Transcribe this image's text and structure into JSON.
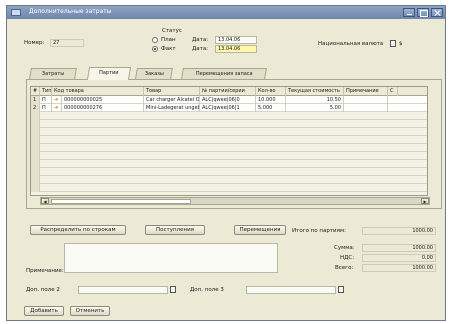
{
  "window": {
    "title": "Дополнительные затраты"
  },
  "header": {
    "number_label": "Номер:",
    "number_value": "27",
    "status_label": "Статус",
    "status_plan": "План",
    "status_fact": "Факт",
    "date_label": "Дата:",
    "date_plan": "13.04.06",
    "date_fact": "13.04.06",
    "currency_label": "Национальная валюта",
    "currency_value": "$"
  },
  "tabs": [
    "Затраты",
    "Партии",
    "Заказы",
    "Перемещения запаса"
  ],
  "grid": {
    "columns": [
      "#",
      "Тип",
      "Код товара",
      "Товар",
      "№ партии/серии",
      "Кол-во",
      "Текущая стоимость",
      "Примечание",
      "С"
    ],
    "rows": [
      {
        "n": "1",
        "type": "П",
        "code": "000000000025",
        "item": "Car charger Alcatel OT",
        "batch": "ALC|qwee|06|0",
        "qty": "10.000",
        "cost": "10.50",
        "note": ""
      },
      {
        "n": "2",
        "type": "П",
        "code": "000000000276",
        "item": "Mini-Ladegerat ungebl",
        "batch": "ALC|qwee|06|1",
        "qty": "5.000",
        "cost": "5.00",
        "note": ""
      }
    ]
  },
  "buttons": {
    "distribute": "Распределить по строкам",
    "receipts": "Поступления",
    "moves": "Перемещения",
    "add": "Добавить",
    "cancel": "Отменить"
  },
  "totals": {
    "by_batches_label": "Итого по партиям:",
    "by_batches_value": "1000.00",
    "sum_label": "Сумма:",
    "sum_value": "1000.00",
    "vat_label": "НДС:",
    "vat_value": "0.00",
    "total_label": "Всего:",
    "total_value": "1000.00"
  },
  "footer": {
    "note_label": "Примечание:",
    "field2_label": "Доп. поле 2",
    "field3_label": "Доп. поле 3"
  },
  "colors": {
    "title_bar": "#7890b8",
    "window_bg": "#ece9d4",
    "field_highlight": "#fff7a8",
    "scroll_thumb": "#a9c2b5"
  }
}
